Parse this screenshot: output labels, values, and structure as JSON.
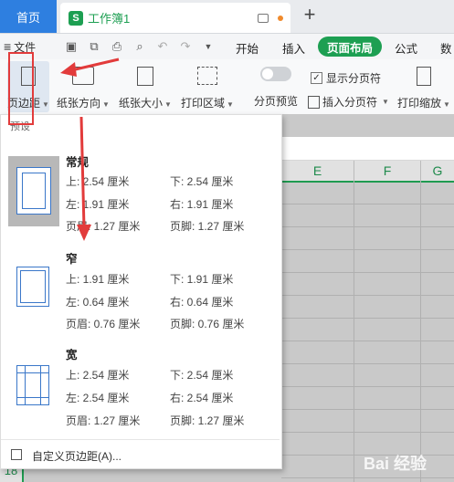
{
  "tabs": {
    "home": "首页",
    "document": "工作簿1",
    "doc_icon": "S"
  },
  "menu": {
    "file": "文件",
    "items": [
      "开始",
      "插入",
      "页面布局",
      "公式",
      "数"
    ],
    "active": "页面布局"
  },
  "ribbon": {
    "margins": "页边距",
    "orientation": "纸张方向",
    "size": "纸张大小",
    "print_area": "打印区域",
    "page_break_preview": "分页预览",
    "show_page_breaks": "显示分页符",
    "insert_page_break": "插入分页符",
    "print_scale": "打印缩放"
  },
  "sheet": {
    "columns": [
      "E",
      "F",
      "G"
    ],
    "row_number": "18"
  },
  "dropdown": {
    "preset_label": "预设",
    "presets": [
      {
        "name": "常规",
        "top": "上: 2.54 厘米",
        "bottom": "下: 2.54 厘米",
        "left": "左: 1.91 厘米",
        "right": "右: 1.91 厘米",
        "header": "页眉: 1.27 厘米",
        "footer": "页脚: 1.27 厘米"
      },
      {
        "name": "窄",
        "top": "上: 1.91 厘米",
        "bottom": "下: 1.91 厘米",
        "left": "左: 0.64 厘米",
        "right": "右: 0.64 厘米",
        "header": "页眉: 0.76 厘米",
        "footer": "页脚: 0.76 厘米"
      },
      {
        "name": "宽",
        "top": "上: 2.54 厘米",
        "bottom": "下: 2.54 厘米",
        "left": "左: 2.54 厘米",
        "right": "右: 2.54 厘米",
        "header": "页眉: 1.27 厘米",
        "footer": "页脚: 1.27 厘米"
      }
    ],
    "custom": "自定义页边距(A)..."
  },
  "watermark": "Bai 经验",
  "colors": {
    "accent": "#1d9f52",
    "home_tab": "#2e7fe0",
    "highlight": "#e23b3b"
  }
}
